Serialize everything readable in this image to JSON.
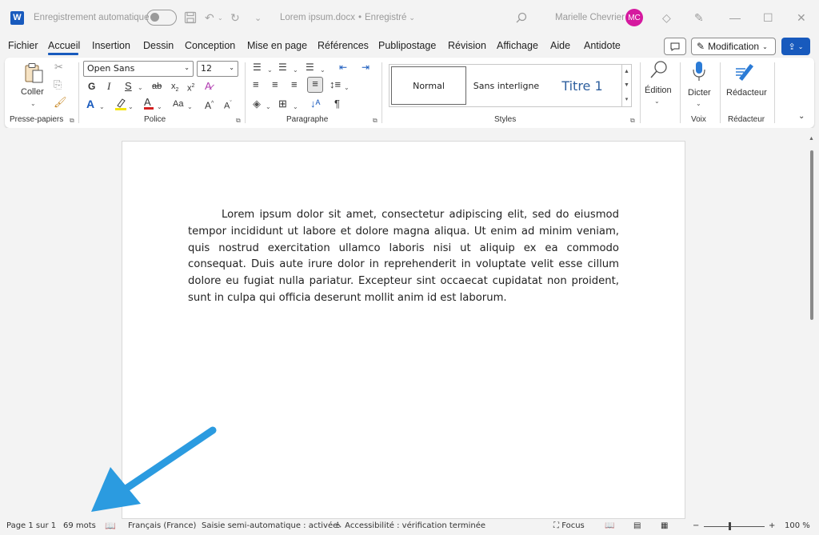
{
  "titlebar": {
    "app_badge": "W",
    "autosave_label": "Enregistrement automatique",
    "doc_title": "Lorem ipsum.docx",
    "doc_status": "Enregistré",
    "user_name": "Marielle Chevrier",
    "avatar_initials": "MC"
  },
  "tabs": [
    "Fichier",
    "Accueil",
    "Insertion",
    "Dessin",
    "Conception",
    "Mise en page",
    "Références",
    "Publipostage",
    "Révision",
    "Affichage",
    "Aide",
    "Antidote"
  ],
  "active_tab": "Accueil",
  "actions": {
    "modification_label": "Modification"
  },
  "ribbon": {
    "clipboard": {
      "paste_label": "Coller",
      "group_label": "Presse-papiers"
    },
    "font": {
      "font_name": "Open Sans",
      "font_size": "12",
      "group_label": "Police",
      "bold": "G",
      "italic": "I",
      "underline": "S"
    },
    "paragraph": {
      "group_label": "Paragraphe"
    },
    "styles": {
      "items": [
        "Normal",
        "Sans interligne",
        "Titre 1"
      ],
      "group_label": "Styles"
    },
    "editing": {
      "label": "Édition"
    },
    "voice": {
      "dictate_label": "Dicter",
      "group_label": "Voix"
    },
    "editor": {
      "label": "Rédacteur",
      "group_label": "Rédacteur"
    }
  },
  "document": {
    "paragraph": "Lorem ipsum dolor sit amet, consectetur adipiscing elit, sed do eiusmod tempor incididunt ut labore et dolore magna aliqua. Ut enim ad minim veniam, quis nostrud exercitation ullamco laboris nisi ut aliquip ex ea commodo consequat. Duis aute irure dolor in reprehenderit in voluptate velit esse cillum dolore eu fugiat nulla pariatur. Excepteur sint occaecat cupidatat non proident, sunt in culpa qui officia deserunt mollit anim id est laborum."
  },
  "statusbar": {
    "page": "Page 1 sur 1",
    "words": "69 mots",
    "language": "Français (France)",
    "autocomplete": "Saisie semi-automatique : activée",
    "accessibility": "Accessibilité : vérification terminée",
    "focus": "Focus",
    "zoom": "100 %"
  },
  "colors": {
    "accent": "#185abd",
    "avatar": "#d5199f",
    "arrow": "#2b9be0"
  }
}
